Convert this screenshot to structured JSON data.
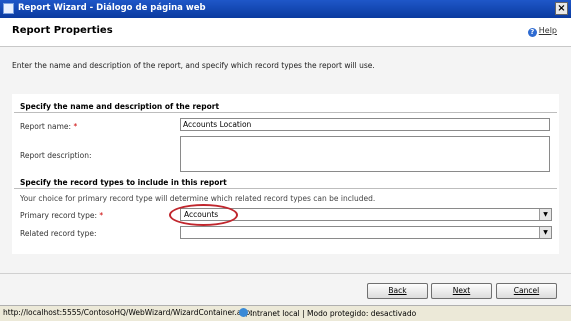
{
  "window": {
    "title": "Report Wizard - Diálogo de página web",
    "close_symbol": "×"
  },
  "header": {
    "title": "Report Properties",
    "help_label": "Help",
    "help_symbol": "?"
  },
  "intro": "Enter the name and description of the report, and specify which record types the report will use.",
  "section1": {
    "title": "Specify the name and description of the report",
    "report_name_label": "Report name:",
    "report_name_value": "Accounts Location",
    "description_label": "Report description:",
    "description_value": ""
  },
  "section2": {
    "title": "Specify the record types to include in this report",
    "hint": "Your choice for primary record type will determine which related record types can be included.",
    "primary_label": "Primary record type:",
    "primary_value": "Accounts",
    "related_label": "Related record type:",
    "related_value": "",
    "arrow": "▼"
  },
  "required_marker": "*",
  "buttons": {
    "back": "Back",
    "next": "Next",
    "cancel": "Cancel"
  },
  "status": {
    "url": "http://localhost:5555/ContosoHQ/WebWizard/WizardContainer.asp:",
    "zone": "Intranet local | Modo protegido: desactivado"
  }
}
